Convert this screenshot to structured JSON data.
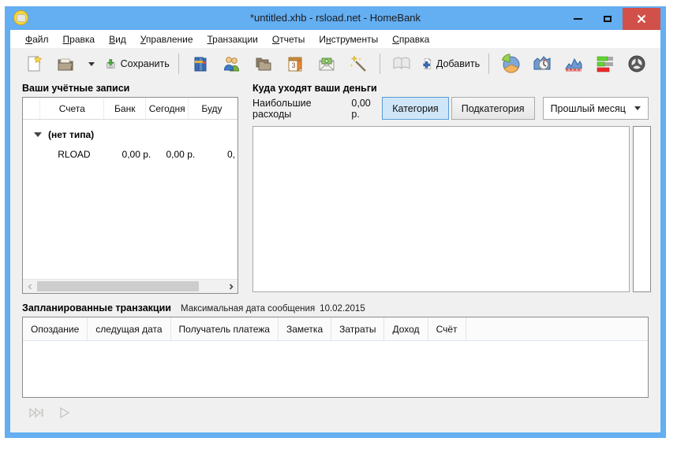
{
  "window": {
    "title": "*untitled.xhb - rsload.net - HomeBank"
  },
  "colors": {
    "titlebar_blue": "#64aef2",
    "close_red": "#d2504a",
    "toggle_active_bg": "#cfe6f8",
    "toggle_active_border": "#5b9bd5"
  },
  "menu": {
    "items": [
      {
        "pre": "",
        "key": "Ф",
        "post": "айл"
      },
      {
        "pre": "",
        "key": "П",
        "post": "равка"
      },
      {
        "pre": "",
        "key": "В",
        "post": "ид"
      },
      {
        "pre": "",
        "key": "У",
        "post": "правление"
      },
      {
        "pre": "",
        "key": "Т",
        "post": "ранзакции"
      },
      {
        "pre": "",
        "key": "О",
        "post": "тчеты"
      },
      {
        "pre": "И",
        "key": "н",
        "post": "струменты"
      },
      {
        "pre": "",
        "key": "С",
        "post": "правка"
      }
    ]
  },
  "toolbar": {
    "save_label": "Сохранить",
    "add_label": "Добавить",
    "calendar_day": "3",
    "icons": [
      "new-file-icon",
      "open-folder-icon",
      "dropdown-caret",
      "save-icon",
      "books-icon",
      "people-icon",
      "folders-icon",
      "calendar-icon",
      "envelope-money-icon",
      "magic-wand-icon",
      "book-icon",
      "add-plus-icon",
      "pie-chart-icon",
      "area-chart-clock-icon",
      "line-chart-icon",
      "bar-chart-icon",
      "steering-wheel-icon"
    ]
  },
  "accounts": {
    "title": "Ваши учётные записи",
    "columns": [
      "Счета",
      "Банк",
      "Сегодня",
      "Буду"
    ],
    "group_label": "(нет типа)",
    "rows": [
      {
        "name": "RLOAD",
        "bank": "0,00 р.",
        "today": "0,00 р.",
        "future": "0,"
      }
    ]
  },
  "spending": {
    "title": "Куда уходят ваши деньги",
    "label": "Наибольшие расходы",
    "amount": "0,00 р.",
    "category_button": "Категория",
    "subcategory_button": "Подкатегория",
    "range_value": "Прошлый месяц"
  },
  "scheduled": {
    "title": "Запланированные транзакции",
    "note_label": "Максимальная дата сообщения",
    "note_date": "10.02.2015",
    "columns": [
      "Опоздание",
      "следущая дата",
      "Получатель платежа",
      "Заметка",
      "Затраты",
      "Доход",
      "Счёт"
    ]
  }
}
